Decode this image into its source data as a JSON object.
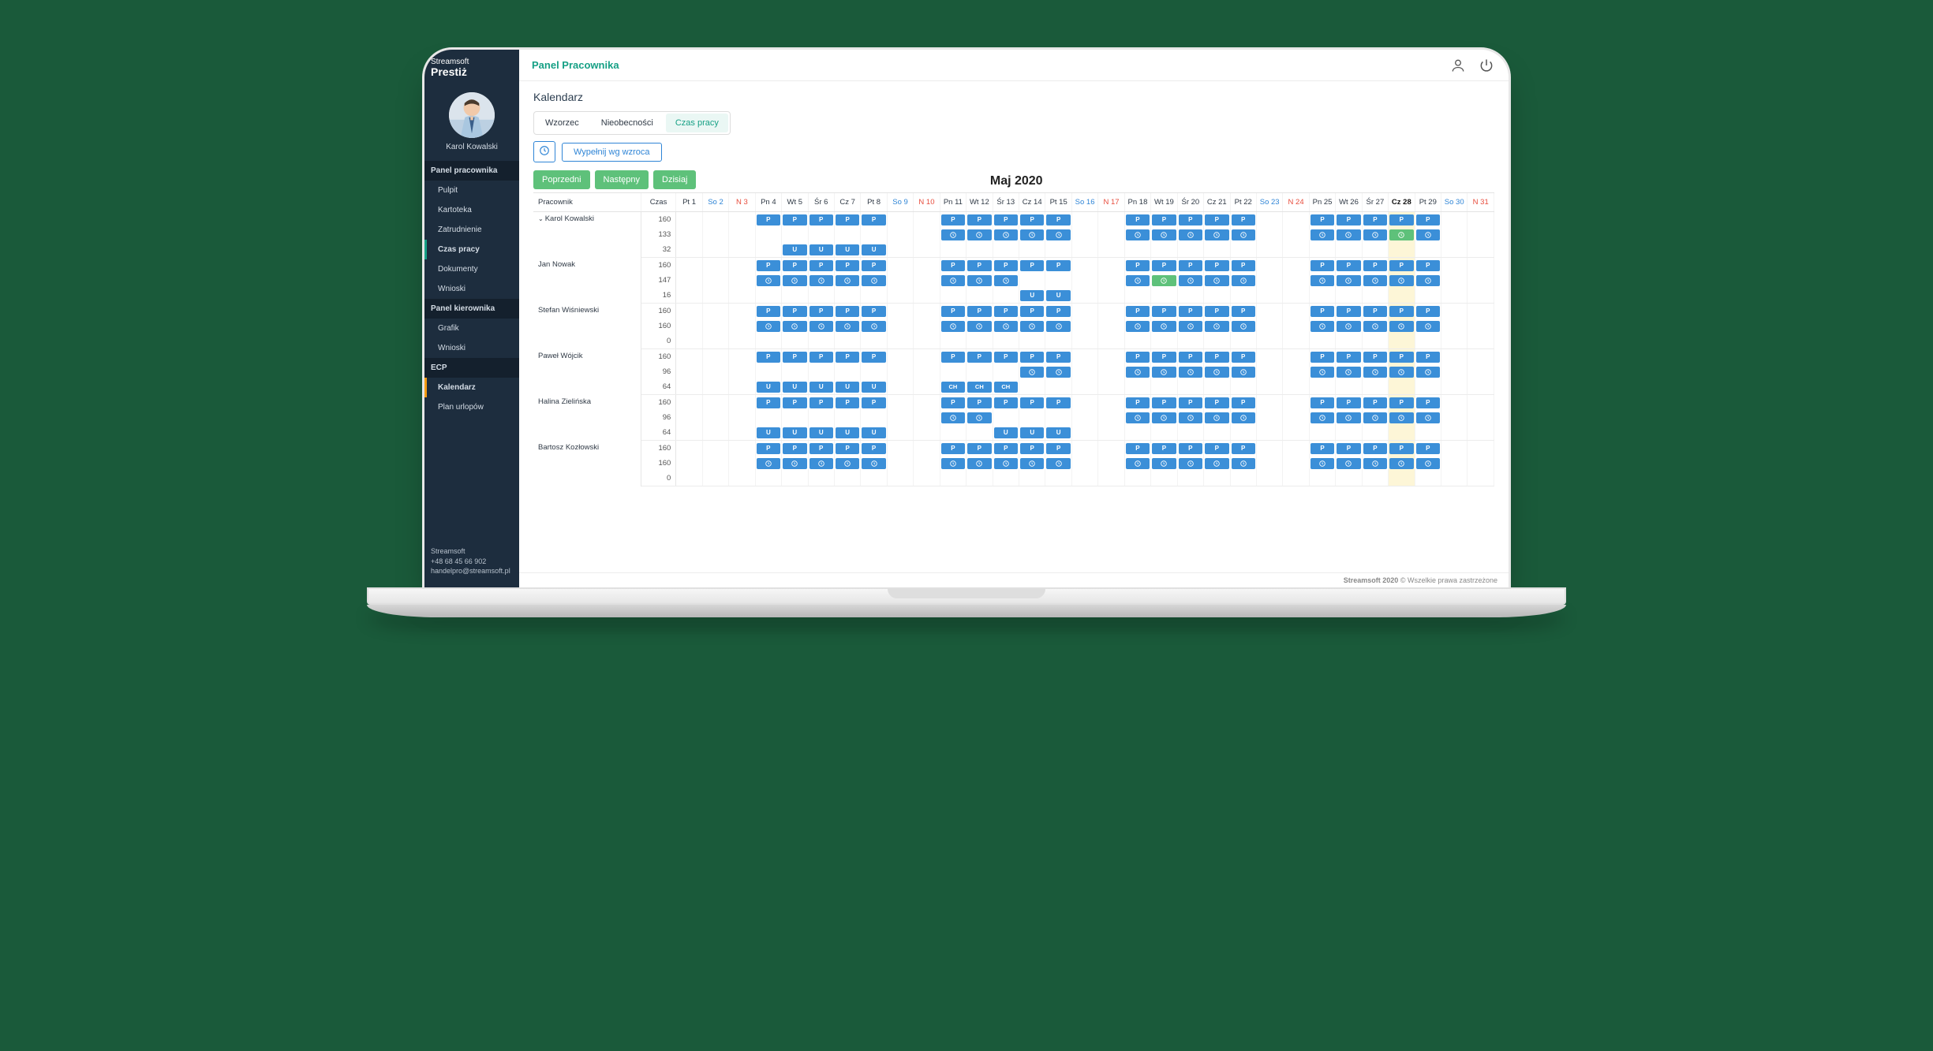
{
  "brand": {
    "small": "Streamsoft",
    "large": "Prestiż"
  },
  "user": {
    "name": "Karol Kowalski"
  },
  "sidebar": {
    "sections": [
      {
        "title": "Panel pracownika",
        "items": [
          "Pulpit",
          "Kartoteka",
          "Zatrudnienie",
          "Czas pracy",
          "Dokumenty",
          "Wnioski"
        ]
      },
      {
        "title": "Panel kierownika",
        "items": [
          "Grafik",
          "Wnioski"
        ]
      },
      {
        "title": "ECP",
        "items": [
          "Kalendarz",
          "Plan urlopów"
        ]
      }
    ],
    "footer": {
      "company": "Streamsoft",
      "phone": "+48 68 45 66 902",
      "email": "handelpro@streamsoft.pl"
    }
  },
  "header": {
    "title": "Panel Pracownika"
  },
  "page": {
    "title": "Kalendarz"
  },
  "tabs": [
    "Wzorzec",
    "Nieobecności",
    "Czas pracy"
  ],
  "activeTab": 2,
  "toolbar": {
    "fill": "Wypełnij wg wzroca"
  },
  "nav": {
    "prev": "Poprzedni",
    "next": "Następny",
    "today": "Dzisiaj"
  },
  "month": "Maj 2020",
  "cols": {
    "employee": "Pracownik",
    "time": "Czas"
  },
  "days": [
    {
      "h": "Pt 1",
      "t": "",
      "i": 1
    },
    {
      "h": "So 2",
      "t": "sat",
      "i": 2
    },
    {
      "h": "N 3",
      "t": "sun",
      "i": 3
    },
    {
      "h": "Pn 4",
      "t": "",
      "i": 4
    },
    {
      "h": "Wt 5",
      "t": "",
      "i": 5
    },
    {
      "h": "Śr 6",
      "t": "",
      "i": 6
    },
    {
      "h": "Cz 7",
      "t": "",
      "i": 7
    },
    {
      "h": "Pt 8",
      "t": "",
      "i": 8
    },
    {
      "h": "So 9",
      "t": "sat",
      "i": 9
    },
    {
      "h": "N 10",
      "t": "sun",
      "i": 10
    },
    {
      "h": "Pn 11",
      "t": "",
      "i": 11
    },
    {
      "h": "Wt 12",
      "t": "",
      "i": 12
    },
    {
      "h": "Śr 13",
      "t": "",
      "i": 13
    },
    {
      "h": "Cz 14",
      "t": "",
      "i": 14
    },
    {
      "h": "Pt 15",
      "t": "",
      "i": 15
    },
    {
      "h": "So 16",
      "t": "sat",
      "i": 16
    },
    {
      "h": "N 17",
      "t": "sun",
      "i": 17
    },
    {
      "h": "Pn 18",
      "t": "",
      "i": 18
    },
    {
      "h": "Wt 19",
      "t": "",
      "i": 19
    },
    {
      "h": "Śr 20",
      "t": "",
      "i": 20
    },
    {
      "h": "Cz 21",
      "t": "",
      "i": 21
    },
    {
      "h": "Pt 22",
      "t": "",
      "i": 22
    },
    {
      "h": "So 23",
      "t": "sat",
      "i": 23
    },
    {
      "h": "N 24",
      "t": "sun",
      "i": 24
    },
    {
      "h": "Pn 25",
      "t": "",
      "i": 25
    },
    {
      "h": "Wt 26",
      "t": "",
      "i": 26
    },
    {
      "h": "Śr 27",
      "t": "",
      "i": 27
    },
    {
      "h": "Cz 28",
      "t": "today",
      "i": 28
    },
    {
      "h": "Pt 29",
      "t": "",
      "i": 29
    },
    {
      "h": "So 30",
      "t": "sat",
      "i": 30
    },
    {
      "h": "N 31",
      "t": "sun",
      "i": 31
    }
  ],
  "employees": [
    {
      "name": "Karol Kowalski",
      "expand": true,
      "czas": [
        160,
        133,
        32
      ],
      "rows": [
        {
          "type": "P",
          "days": [
            4,
            5,
            6,
            7,
            8,
            11,
            12,
            13,
            14,
            15,
            18,
            19,
            20,
            21,
            22,
            25,
            26,
            27,
            28,
            29
          ]
        },
        {
          "type": "C",
          "days": [
            11,
            12,
            13,
            14,
            15,
            18,
            19,
            20,
            21,
            22,
            25,
            26,
            27,
            28,
            29
          ],
          "green": [
            28
          ]
        },
        {
          "type": "U",
          "days": [
            5,
            6,
            7,
            8
          ]
        }
      ]
    },
    {
      "name": "Jan Nowak",
      "czas": [
        160,
        147,
        16
      ],
      "rows": [
        {
          "type": "P",
          "days": [
            4,
            5,
            6,
            7,
            8,
            11,
            12,
            13,
            14,
            15,
            18,
            19,
            20,
            21,
            22,
            25,
            26,
            27,
            28,
            29
          ]
        },
        {
          "type": "C",
          "days": [
            4,
            5,
            6,
            7,
            8,
            11,
            12,
            13,
            18,
            19,
            20,
            21,
            22,
            25,
            26,
            27,
            28,
            29
          ],
          "green": [
            19
          ]
        },
        {
          "type": "U",
          "days": [
            14,
            15
          ]
        }
      ]
    },
    {
      "name": "Stefan Wiśniewski",
      "czas": [
        160,
        160,
        0
      ],
      "rows": [
        {
          "type": "P",
          "days": [
            4,
            5,
            6,
            7,
            8,
            11,
            12,
            13,
            14,
            15,
            18,
            19,
            20,
            21,
            22,
            25,
            26,
            27,
            28,
            29
          ]
        },
        {
          "type": "C",
          "days": [
            4,
            5,
            6,
            7,
            8,
            11,
            12,
            13,
            14,
            15,
            18,
            19,
            20,
            21,
            22,
            25,
            26,
            27,
            28,
            29
          ]
        },
        {
          "type": "none",
          "days": []
        }
      ]
    },
    {
      "name": "Paweł Wójcik",
      "czas": [
        160,
        96,
        64
      ],
      "rows": [
        {
          "type": "P",
          "days": [
            4,
            5,
            6,
            7,
            8,
            11,
            12,
            13,
            14,
            15,
            18,
            19,
            20,
            21,
            22,
            25,
            26,
            27,
            28,
            29
          ]
        },
        {
          "type": "C",
          "days": [
            14,
            15,
            18,
            19,
            20,
            21,
            22,
            25,
            26,
            27,
            28,
            29
          ]
        },
        {
          "type": "mix",
          "days": [
            4,
            5,
            6,
            7,
            8
          ],
          "uDays": [
            4,
            5,
            6,
            7,
            8
          ],
          "chDays": [
            11,
            12,
            13
          ]
        }
      ]
    },
    {
      "name": "Halina Zielińska",
      "czas": [
        160,
        96,
        64
      ],
      "rows": [
        {
          "type": "P",
          "days": [
            4,
            5,
            6,
            7,
            8,
            11,
            12,
            13,
            14,
            15,
            18,
            19,
            20,
            21,
            22,
            25,
            26,
            27,
            28,
            29
          ]
        },
        {
          "type": "C",
          "days": [
            11,
            12,
            18,
            19,
            20,
            21,
            22,
            25,
            26,
            27,
            28,
            29
          ]
        },
        {
          "type": "U",
          "days": [
            4,
            5,
            6,
            7,
            8,
            13,
            14,
            15
          ]
        }
      ]
    },
    {
      "name": "Bartosz Kozłowski",
      "czas": [
        160,
        160,
        0
      ],
      "rows": [
        {
          "type": "P",
          "days": [
            4,
            5,
            6,
            7,
            8,
            11,
            12,
            13,
            14,
            15,
            18,
            19,
            20,
            21,
            22,
            25,
            26,
            27,
            28,
            29
          ]
        },
        {
          "type": "C",
          "days": [
            4,
            5,
            6,
            7,
            8,
            11,
            12,
            13,
            14,
            15,
            18,
            19,
            20,
            21,
            22,
            25,
            26,
            27,
            28,
            29
          ]
        },
        {
          "type": "none",
          "days": []
        }
      ]
    }
  ],
  "footer": {
    "brand": "Streamsoft 2020",
    "text": " © Wszelkie prawa zastrzeżone"
  }
}
